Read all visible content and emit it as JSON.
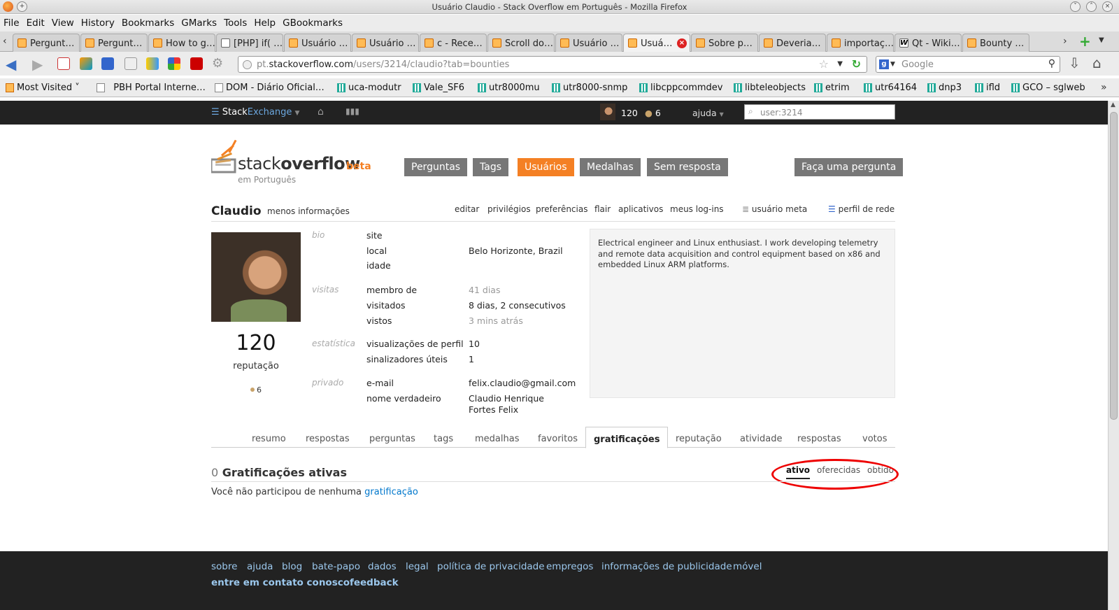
{
  "window": {
    "title": "Usuário Claudio - Stack Overflow em Português - Mozilla Firefox"
  },
  "menu": [
    "File",
    "Edit",
    "View",
    "History",
    "Bookmarks",
    "GMarks",
    "Tools",
    "Help",
    "GBookmarks"
  ],
  "tabs": [
    "Pergunt…",
    "Pergunt…",
    "How to g…",
    "[PHP] if( …",
    "Usuário …",
    "Usuário …",
    "c - Rece…",
    "Scroll do…",
    "Usuário …",
    "Usuá…",
    "Sobre p…",
    "Deveria…",
    "importaç…",
    "Qt - Wiki…",
    "Bounty …"
  ],
  "nav": {
    "url_prefix": "pt.",
    "url_domain": "stackoverflow.com",
    "url_path": "/users/3214/claudio?tab=bounties",
    "search_placeholder": "Google"
  },
  "bookmarks": [
    "Most Visited",
    "PBH Portal Interne…",
    "DOM - Diário Oficial…",
    "uca-modutr",
    "Vale_SF6",
    "utr8000mu",
    "utr8000-snmp",
    "libcppcommdev",
    "libteleobjects",
    "etrim",
    "utr64164",
    "dnp3",
    "ifld",
    "GCO – sglweb"
  ],
  "se": {
    "brand_a": "Stack",
    "brand_b": "Exchange",
    "rep": "120",
    "badges": "6",
    "help": "ajuda",
    "search_value": "user:3214"
  },
  "site": {
    "logo_a": "stack",
    "logo_b": "overflow",
    "beta": "beta",
    "sub": "em Português"
  },
  "navbtns": [
    "Perguntas",
    "Tags",
    "Usuários",
    "Medalhas",
    "Sem resposta"
  ],
  "ask": "Faça uma pergunta",
  "profile": {
    "name": "Claudio",
    "less_info": "menos informações",
    "links": [
      "editar",
      "privilégios",
      "preferências",
      "flair",
      "aplicativos",
      "meus log-ins"
    ],
    "meta_user": "usuário meta",
    "network_profile": "perfil de rede",
    "reputation": "120",
    "reputation_label": "reputação",
    "badge_count": "6",
    "bio_label": "bio",
    "site_k": "site",
    "local_k": "local",
    "local_v": "Belo Horizonte, Brazil",
    "idade_k": "idade",
    "visits_label": "visitas",
    "member_k": "membro de",
    "member_v": "41 dias",
    "visited_k": "visitados",
    "visited_v": "8 dias, 2 consecutivos",
    "seen_k": "vistos",
    "seen_v": "3 mins atrás",
    "stats_label": "estatística",
    "views_k": "visualizações de perfil",
    "views_v": "10",
    "flags_k": "sinalizadores úteis",
    "flags_v": "1",
    "private_label": "privado",
    "email_k": "e-mail",
    "email_v": "felix.claudio@gmail.com",
    "realname_k": "nome verdadeiro",
    "realname_v": "Claudio Henrique Fortes Felix",
    "bio": "Electrical engineer and Linux enthusiast. I work developing telemetry and remote data acquisition and control equipment based on x86 and embedded Linux ARM platforms."
  },
  "profile_tabs": [
    "resumo",
    "respostas",
    "perguntas",
    "tags",
    "medalhas",
    "favoritos",
    "gratificações",
    "reputação",
    "atividade",
    "respostas",
    "votos"
  ],
  "bounties": {
    "count": "0",
    "title": "Gratificações ativas",
    "subtabs": [
      "ativo",
      "oferecidas",
      "obtido"
    ],
    "empty": "Você não participou de nenhuma",
    "empty_link": "gratificação"
  },
  "footer": {
    "links": [
      "sobre",
      "ajuda",
      "blog",
      "bate-papo",
      "dados",
      "legal",
      "política de privacidade",
      "empregos",
      "informações de publicidade",
      "móvel"
    ],
    "contact": "entre em contato conosco",
    "feedback": "feedback"
  }
}
